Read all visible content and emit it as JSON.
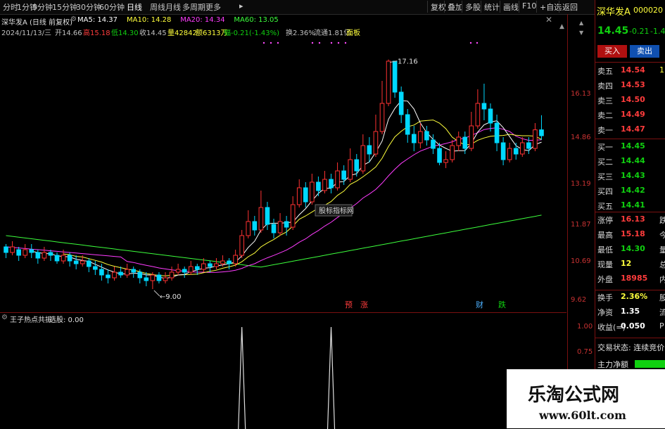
{
  "toolbar": {
    "tabs": [
      "分时",
      "1分钟",
      "5分钟",
      "15分钟",
      "30分钟",
      "60分钟",
      "日线",
      "周线",
      "月线",
      "多周期",
      "更多"
    ],
    "active_tab": "日线",
    "buttons": [
      "复权",
      "叠加",
      "多股",
      "统计",
      "画线",
      "F10",
      "+自选",
      "返回"
    ]
  },
  "header": {
    "title": "深华发A (日线 前复权)",
    "ma": [
      {
        "label": "MA5: 14.37",
        "color": "#ffffff"
      },
      {
        "label": "MA10: 14.28",
        "color": "#ffff3c"
      },
      {
        "label": "MA20: 14.34",
        "color": "#ff3cff"
      },
      {
        "label": "MA60: 13.05",
        "color": "#3cff3c"
      }
    ],
    "info_line": [
      {
        "text": "2024/11/13/三",
        "color": "#c0c0c0"
      },
      {
        "text": "开14.66",
        "color": "#c0c0c0"
      },
      {
        "text": "高15.18",
        "color": "#ff3c3c"
      },
      {
        "text": "低14.30",
        "color": "#10d010"
      },
      {
        "text": "收14.45",
        "color": "#c0c0c0"
      },
      {
        "text": "量42842",
        "color": "#ffff3c"
      },
      {
        "text": "额6313万",
        "color": "#ffff3c"
      },
      {
        "text": "幅-0.21(-1.43%)",
        "color": "#10d010"
      },
      {
        "text": "换2.36%",
        "color": "#c0c0c0"
      },
      {
        "text": "流通1.81亿",
        "color": "#c0c0c0"
      },
      {
        "text": "面板",
        "color": "#ffff3c"
      }
    ]
  },
  "chart": {
    "price_labels": [
      "16.13",
      "14.86",
      "13.19",
      "11.87",
      "10.69",
      "9.62"
    ],
    "high_annotation": "17.16",
    "low_annotation": "9.00",
    "overlay_label": "股标指标网",
    "event_labels": [
      {
        "text": "预",
        "color": "#ff3c3c"
      },
      {
        "text": "涨",
        "color": "#ff3c3c"
      },
      {
        "text": "财",
        "color": "#4cb0ff"
      },
      {
        "text": "跌",
        "color": "#10d010"
      }
    ],
    "colors": {
      "up": "#ff3232",
      "down": "#00d8ff",
      "ma5": "#ffffff",
      "ma10": "#ffff3c",
      "ma20": "#ff3cff",
      "ma60": "#3cff3c"
    }
  },
  "chart_data": {
    "type": "candlestick",
    "title": "深华发A (日线 前复权)",
    "candles": [
      [
        10.5,
        10.3,
        10.6,
        10.1
      ],
      [
        10.3,
        10.5,
        10.7,
        10.2
      ],
      [
        10.4,
        10.2,
        10.5,
        10.0
      ],
      [
        10.2,
        10.4,
        10.6,
        10.1
      ],
      [
        10.4,
        10.3,
        10.6,
        10.1
      ],
      [
        10.3,
        10.1,
        10.4,
        9.9
      ],
      [
        10.1,
        10.3,
        10.5,
        10.0
      ],
      [
        10.3,
        10.2,
        10.4,
        10.0
      ],
      [
        10.2,
        10.0,
        10.3,
        9.9
      ],
      [
        10.0,
        10.2,
        10.4,
        9.9
      ],
      [
        10.2,
        10.0,
        10.3,
        9.8
      ],
      [
        10.0,
        9.9,
        10.2,
        9.7
      ],
      [
        9.9,
        10.0,
        10.2,
        9.8
      ],
      [
        10.0,
        9.8,
        10.1,
        9.6
      ],
      [
        9.8,
        9.7,
        10.0,
        9.5
      ],
      [
        9.7,
        9.5,
        9.9,
        9.3
      ],
      [
        9.5,
        9.4,
        9.7,
        9.2
      ],
      [
        9.4,
        9.6,
        9.8,
        9.3
      ],
      [
        9.6,
        9.5,
        9.8,
        9.4
      ],
      [
        9.5,
        9.7,
        9.9,
        9.4
      ],
      [
        9.7,
        9.6,
        9.8,
        9.4
      ],
      [
        9.6,
        9.4,
        9.7,
        9.2
      ],
      [
        9.4,
        9.3,
        9.6,
        9.1
      ],
      [
        9.3,
        9.5,
        9.6,
        9.0
      ],
      [
        9.5,
        9.3,
        9.6,
        9.2
      ],
      [
        9.3,
        9.4,
        9.6,
        9.2
      ],
      [
        9.4,
        9.6,
        9.8,
        9.3
      ],
      [
        9.6,
        9.7,
        9.9,
        9.5
      ],
      [
        9.7,
        9.6,
        9.8,
        9.4
      ],
      [
        9.6,
        9.8,
        10.0,
        9.5
      ],
      [
        9.8,
        9.7,
        9.9,
        9.5
      ],
      [
        9.7,
        9.9,
        10.1,
        9.6
      ],
      [
        9.9,
        9.8,
        10.0,
        9.6
      ],
      [
        9.8,
        9.9,
        10.1,
        9.7
      ],
      [
        9.9,
        10.0,
        10.2,
        9.8
      ],
      [
        10.0,
        9.9,
        10.1,
        9.7
      ],
      [
        9.9,
        10.2,
        10.4,
        9.8
      ],
      [
        10.2,
        10.9,
        11.1,
        10.1
      ],
      [
        10.9,
        11.4,
        11.8,
        10.8
      ],
      [
        11.4,
        11.1,
        11.6,
        10.9
      ],
      [
        11.1,
        11.9,
        12.5,
        11.0
      ],
      [
        11.9,
        11.3,
        12.1,
        11.1
      ],
      [
        11.3,
        11.0,
        11.5,
        10.8
      ],
      [
        11.0,
        11.4,
        11.7,
        10.9
      ],
      [
        11.4,
        11.2,
        11.6,
        10.9
      ],
      [
        11.2,
        12.0,
        12.3,
        11.1
      ],
      [
        12.0,
        12.6,
        12.9,
        11.9
      ],
      [
        12.6,
        12.1,
        12.8,
        11.9
      ],
      [
        12.1,
        12.8,
        13.1,
        12.0
      ],
      [
        12.8,
        12.5,
        13.0,
        12.3
      ],
      [
        12.5,
        12.9,
        13.2,
        12.4
      ],
      [
        12.9,
        12.6,
        13.1,
        12.4
      ],
      [
        12.6,
        13.2,
        13.5,
        12.5
      ],
      [
        13.2,
        12.9,
        13.4,
        12.7
      ],
      [
        12.9,
        13.6,
        14.0,
        12.8
      ],
      [
        13.6,
        13.2,
        13.8,
        13.0
      ],
      [
        13.2,
        14.1,
        14.5,
        13.1
      ],
      [
        14.1,
        13.8,
        14.4,
        13.5
      ],
      [
        13.8,
        14.6,
        15.2,
        13.7
      ],
      [
        14.6,
        15.6,
        16.4,
        14.5
      ],
      [
        15.6,
        17.1,
        17.16,
        15.5
      ],
      [
        17.1,
        16.0,
        17.0,
        15.8
      ],
      [
        16.0,
        15.2,
        16.2,
        14.9
      ],
      [
        15.2,
        14.5,
        15.4,
        14.2
      ],
      [
        14.5,
        14.2,
        14.8,
        13.9
      ],
      [
        14.2,
        14.6,
        14.9,
        14.0
      ],
      [
        14.6,
        14.3,
        14.8,
        14.1
      ],
      [
        14.3,
        14.0,
        14.5,
        13.8
      ],
      [
        14.0,
        13.5,
        14.2,
        13.4
      ],
      [
        13.5,
        13.6,
        13.9,
        13.3
      ],
      [
        13.6,
        14.1,
        14.3,
        13.5
      ],
      [
        14.1,
        14.4,
        14.6,
        13.9
      ],
      [
        14.4,
        14.0,
        14.6,
        13.8
      ],
      [
        14.0,
        14.8,
        15.3,
        13.9
      ],
      [
        14.8,
        15.6,
        16.1,
        14.7
      ],
      [
        15.6,
        15.4,
        16.3,
        15.0
      ],
      [
        15.4,
        14.9,
        15.6,
        14.6
      ],
      [
        14.9,
        14.2,
        15.2,
        13.9
      ],
      [
        14.2,
        13.6,
        14.4,
        13.4
      ],
      [
        13.6,
        14.0,
        14.2,
        13.5
      ],
      [
        14.0,
        13.8,
        14.2,
        13.6
      ],
      [
        13.8,
        14.2,
        14.4,
        13.7
      ],
      [
        14.2,
        14.0,
        14.4,
        13.8
      ],
      [
        14.0,
        14.66,
        14.9,
        13.9
      ],
      [
        14.66,
        14.45,
        15.18,
        14.3
      ]
    ],
    "low_label": 9.0,
    "high_label": 17.16,
    "ylim": [
      8.9,
      17.6
    ],
    "indicator": {
      "name": "王子热点共振",
      "value_label": "选股: 0.00",
      "ticks": [
        "1.00",
        "0.75"
      ],
      "spikes_at_index": [
        37,
        51
      ]
    }
  },
  "indicator_panel": {
    "name": "王子热点共振",
    "value": "选股: 0.00",
    "ticks": [
      "1.00",
      "0.75"
    ]
  },
  "quote": {
    "name": "深华发A",
    "code": "000020",
    "price": "14.45",
    "change": "-0.21",
    "pct": "-1.4",
    "buy_btn": "买入",
    "sell_btn": "卖出",
    "asks": [
      {
        "label": "卖五",
        "price": "14.54",
        "vol": "1"
      },
      {
        "label": "卖四",
        "price": "14.53",
        "vol": ""
      },
      {
        "label": "卖三",
        "price": "14.50",
        "vol": ""
      },
      {
        "label": "卖二",
        "price": "14.49",
        "vol": ""
      },
      {
        "label": "卖一",
        "price": "14.47",
        "vol": ""
      }
    ],
    "bids": [
      {
        "label": "买一",
        "price": "14.45",
        "vol": ""
      },
      {
        "label": "买二",
        "price": "14.44",
        "vol": ""
      },
      {
        "label": "买三",
        "price": "14.43",
        "vol": ""
      },
      {
        "label": "买四",
        "price": "14.42",
        "vol": ""
      },
      {
        "label": "买五",
        "price": "14.41",
        "vol": ""
      }
    ],
    "stats": [
      {
        "label": "涨停",
        "val": "16.13",
        "val_color": "#ff3c3c",
        "extra": "跌",
        "extra_color": "#d8d8d8"
      },
      {
        "label": "最高",
        "val": "15.18",
        "val_color": "#ff3c3c",
        "extra": "今",
        "extra_color": "#d8d8d8"
      },
      {
        "label": "最低",
        "val": "14.30",
        "val_color": "#10d010",
        "extra": "量",
        "extra_color": "#d8d8d8"
      },
      {
        "label": "现量",
        "val": "12",
        "val_color": "#ffff3c",
        "extra": "总",
        "extra_color": "#d8d8d8"
      },
      {
        "label": "外盘",
        "val": "18985",
        "val_color": "#ff3c3c",
        "extra": "内",
        "extra_color": "#d8d8d8"
      }
    ],
    "stats2": [
      {
        "label": "换手",
        "val": "2.36%",
        "val_color": "#ffff3c",
        "extra": "股",
        "extra_color": "#d8d8d8"
      },
      {
        "label": "净资",
        "val": "1.35",
        "val_color": "#ffffff",
        "extra": "流",
        "extra_color": "#d8d8d8"
      },
      {
        "label": "收益(=)",
        "val": "0.050",
        "val_color": "#ffffff",
        "extra": "P",
        "extra_color": "#d8d8d8"
      }
    ],
    "trade_state": "交易状态: 连续竞价",
    "main_flow": "主力净额"
  },
  "watermark": {
    "title": "乐淘公式网",
    "url": "www.60lt.com"
  }
}
